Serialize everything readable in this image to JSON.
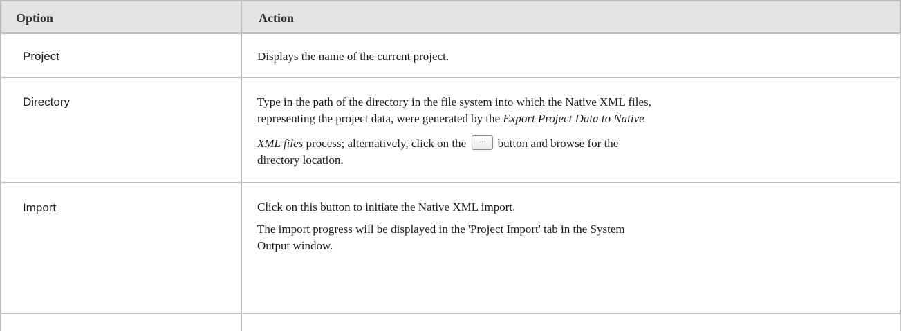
{
  "table": {
    "headers": {
      "option": "Option",
      "action": "Action"
    },
    "rows": [
      {
        "option": "Project",
        "action": "Displays the name of the current project."
      },
      {
        "option": "Directory",
        "action_parts": {
          "line1": "Type in the path of the directory in the file system into which the Native XML files,",
          "line2_a": "representing the project data, were generated by the ",
          "line2_em": "Export Project Data to Native",
          "line3_em": "XML files",
          "line3_a": " process; alternatively, click on the ",
          "line3_b": " button and browse for the",
          "line4": "directory location."
        },
        "browse_button": {
          "icon": "ellipsis-icon",
          "label": "..."
        }
      },
      {
        "option": "Import",
        "action_parts": {
          "p1": "Click on this button to initiate the Native XML import.",
          "p2_line1": "The import progress will be displayed in the 'Project Import' tab in the System",
          "p2_line2": "Output window."
        }
      },
      {
        "option": "",
        "action": ""
      }
    ]
  }
}
